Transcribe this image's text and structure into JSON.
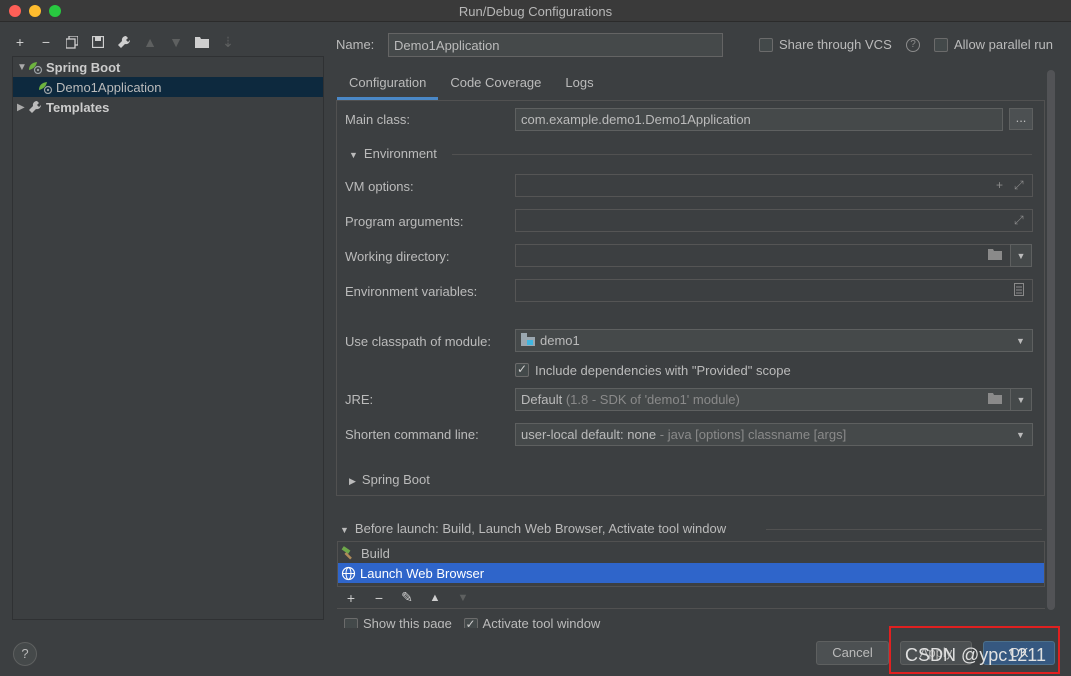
{
  "window": {
    "title": "Run/Debug Configurations"
  },
  "tree": {
    "items": [
      {
        "label": "Spring Boot",
        "expanded": true
      },
      {
        "label": "Demo1Application"
      },
      {
        "label": "Templates",
        "expanded": false
      }
    ]
  },
  "name": {
    "label": "Name:",
    "value": "Demo1Application"
  },
  "share_vcs": {
    "label": "Share through VCS",
    "checked": false
  },
  "allow_parallel": {
    "label": "Allow parallel run",
    "checked": false
  },
  "tabs": [
    {
      "label": "Configuration",
      "active": true
    },
    {
      "label": "Code Coverage"
    },
    {
      "label": "Logs"
    }
  ],
  "form": {
    "main_class": {
      "label": "Main class:",
      "value": "com.example.demo1.Demo1Application",
      "button": "..."
    },
    "environment_section": "Environment",
    "vm_options": {
      "label": "VM options:",
      "value": ""
    },
    "program_arguments": {
      "label": "Program arguments:",
      "value": ""
    },
    "working_directory": {
      "label": "Working directory:",
      "value": ""
    },
    "environment_variables": {
      "label": "Environment variables:",
      "value": ""
    },
    "classpath_module": {
      "label": "Use classpath of module:",
      "value": "demo1"
    },
    "include_deps": {
      "label": "Include dependencies with \"Provided\" scope",
      "checked": true
    },
    "jre": {
      "label": "JRE:",
      "value": "Default",
      "hint": "(1.8 - SDK of 'demo1' module)"
    },
    "shorten_cmd": {
      "label": "Shorten command line:",
      "value": "user-local default: none",
      "hint": "- java [options] classname [args]"
    },
    "spring_boot_section": "Spring Boot"
  },
  "before_launch": {
    "title": "Before launch: Build, Launch Web Browser, Activate tool window",
    "items": [
      {
        "label": "Build"
      },
      {
        "label": "Launch Web Browser",
        "selected": true
      }
    ]
  },
  "show_this_page": {
    "label": "Show this page",
    "checked": false
  },
  "activate_tool_window": {
    "label": "Activate tool window",
    "checked": true
  },
  "buttons": {
    "help": "?",
    "cancel": "Cancel",
    "apply": "Apply",
    "ok": "OK"
  },
  "watermark": "CSDN @ypc1211",
  "colors": {
    "background": "#3c3f41",
    "selection": "#2f65ca",
    "tab_underline": "#4a88c7",
    "highlight_box": "#e02020"
  }
}
